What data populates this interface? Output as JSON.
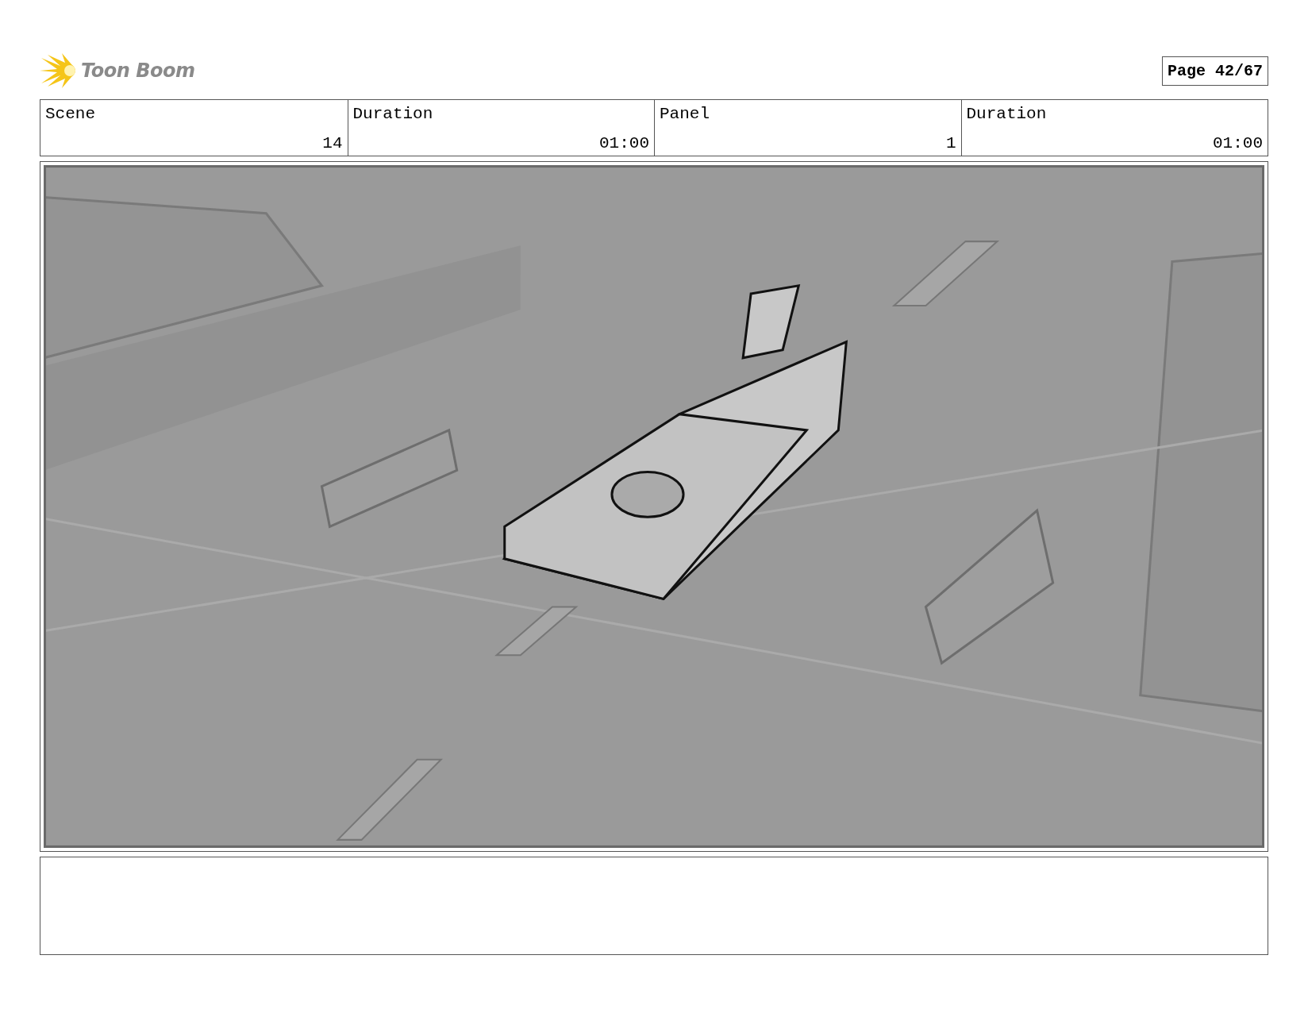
{
  "logo": {
    "text": "Toon Boom"
  },
  "page": "Page 42/67",
  "header": {
    "columns": [
      "Scene",
      "Duration",
      "Panel",
      "Duration"
    ],
    "values": [
      "14",
      "01:00",
      "1",
      "01:00"
    ]
  },
  "panel": {
    "kind": "sketch"
  }
}
